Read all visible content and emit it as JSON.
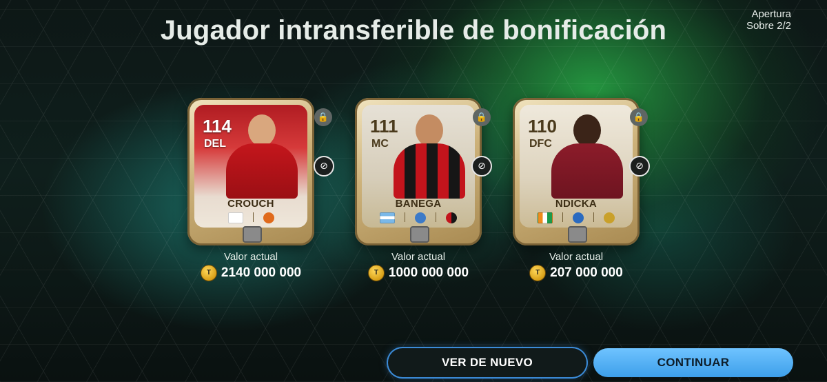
{
  "header": {
    "title": "Jugador intransferible de bonificación",
    "pack_line1": "Apertura",
    "pack_line2": "Sobre 2/2"
  },
  "cards": [
    {
      "rating": "114",
      "position": "DEL",
      "name": "CROUCH",
      "value_label": "Valor actual",
      "value": "2140 000 000",
      "colors": {
        "jersey": "#c4161c"
      }
    },
    {
      "rating": "111",
      "position": "MC",
      "name": "BANEGA",
      "value_label": "Valor actual",
      "value": "1000 000 000",
      "colors": {
        "jersey": "#c3141c"
      }
    },
    {
      "rating": "110",
      "position": "DFC",
      "name": "NDICKA",
      "value_label": "Valor actual",
      "value": "207 000 000",
      "colors": {
        "jersey": "#8c1c2a"
      }
    }
  ],
  "icons": {
    "lock": "lock-icon",
    "untradeable": "untradeable-icon",
    "coin": "coin-icon"
  },
  "buttons": {
    "again": "VER DE NUEVO",
    "continue": "CONTINUAR"
  },
  "colors": {
    "accent_blue": "#3d9fea",
    "background": "#0b1413"
  }
}
